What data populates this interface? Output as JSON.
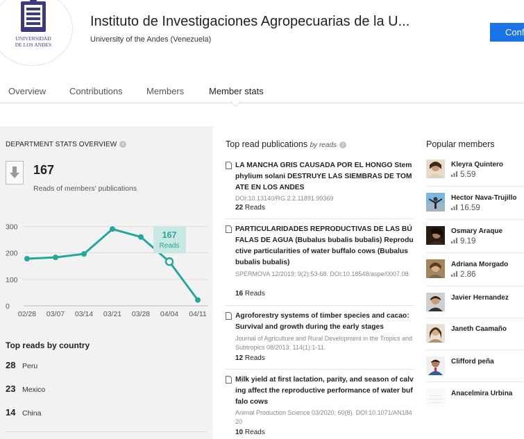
{
  "header": {
    "institute_name": "Instituto de Investigaciones Agropecuarias de la U...",
    "university": "University of the Andes (Venezuela)",
    "confirm_label": "Confi",
    "logo_text_line1": "UNIVERSIDAD",
    "logo_text_line2": "DE LOS ANDES"
  },
  "tabs": [
    {
      "label": "Overview"
    },
    {
      "label": "Contributions"
    },
    {
      "label": "Members"
    },
    {
      "label": "Member stats",
      "active": true
    }
  ],
  "department_stats": {
    "title": "DEPARTMENT STATS OVERVIEW",
    "total_reads": "167",
    "total_reads_label": "Reads of members' publications"
  },
  "chart_data": {
    "type": "line",
    "x": [
      "02/28",
      "03/07",
      "03/14",
      "03/21",
      "03/28",
      "04/04",
      "04/11"
    ],
    "values": [
      178,
      183,
      196,
      290,
      260,
      167,
      22
    ],
    "yticks": [
      "0",
      "100",
      "200",
      "300"
    ],
    "ylim": [
      0,
      330
    ],
    "highlight": {
      "index": 5,
      "value": "167",
      "label": "Reads"
    },
    "color": "#26a69a",
    "grid": true
  },
  "top_countries": {
    "title": "Top reads by country",
    "items": [
      {
        "count": "28",
        "name": "Peru"
      },
      {
        "count": "23",
        "name": "Mexico"
      },
      {
        "count": "14",
        "name": "China"
      }
    ]
  },
  "publications": {
    "title": "Top read publications",
    "subtitle": "by reads",
    "items": [
      {
        "title": "LA MANCHA GRIS CAUSADA POR EL HONGO Stemphylium solani DESTRUYE LAS SIEMBRAS DE TOMATE EN LOS ANDES",
        "meta": "DOI:10.13140/RG.2.2.11891.99369",
        "reads_count": "22",
        "reads_label": "Reads"
      },
      {
        "title": "PARTICULARIDADES REPRODUCTIVAS DE LAS BÚFALAS DE AGUA (Bubalus bubalis bubalis) Reproductive particularities of water buffalo cows (Bubalus bubalis bubalis)",
        "meta": "SPERMOVA 12/2019; 9(2):53-68. DOI:10.18548/aspe/0007.08",
        "reads_count": "16",
        "reads_label": "Reads"
      },
      {
        "title": "Agroforestry systems of timber species and cacao: Survival and growth during the early stages",
        "meta": "Journal of Agriculture and Rural Development in the Tropics and Subtropics 08/2013; 114(1):1-11.",
        "reads_count": "12",
        "reads_label": "Reads"
      },
      {
        "title": "Milk yield at first lactation, parity, and season of calving affect the reproductive performance of water buffalo cows",
        "meta": "Animal Production Science 03/2020; 60(8). DOI:10.1071/AN18420",
        "reads_count": "10",
        "reads_label": "Reads"
      }
    ]
  },
  "members": {
    "title": "Popular members",
    "items": [
      {
        "name": "Kleyra Quintero",
        "score": "5.59"
      },
      {
        "name": "Hector Nava-Trujillo",
        "score": "16.59"
      },
      {
        "name": "Osmary Araque",
        "score": "9.19"
      },
      {
        "name": "Adriana Morgado",
        "score": "2.86"
      },
      {
        "name": "Javier Hernandez",
        "score": ""
      },
      {
        "name": "Janeth Caamaño",
        "score": ""
      },
      {
        "name": "Clifford peña",
        "score": ""
      },
      {
        "name": "Anacelmira Urbina",
        "score": ""
      }
    ]
  },
  "colors": {
    "accent": "#1a73e8",
    "chart_line": "#26a69a",
    "panel_bg": "#f2f2f2"
  }
}
